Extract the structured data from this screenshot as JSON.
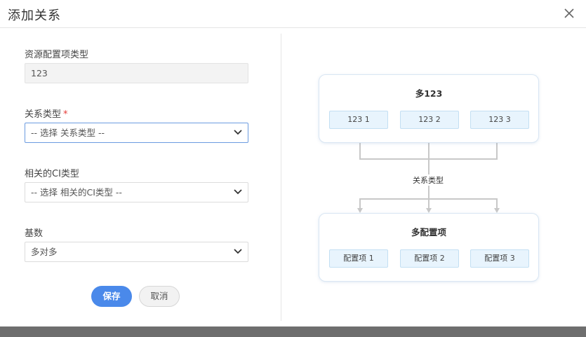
{
  "dialog": {
    "title": "添加关系",
    "close_icon": "close-icon"
  },
  "form": {
    "ci_type": {
      "label": "资源配置项类型",
      "value": "123"
    },
    "relation_type": {
      "label": "关系类型",
      "required_mark": "*",
      "value": "-- 选择 关系类型 --"
    },
    "related_ci_type": {
      "label": "相关的CI类型",
      "value": "-- 选择 相关的CI类型 --"
    },
    "cardinality": {
      "label": "基数",
      "value": "多对多"
    },
    "save_label": "保存",
    "cancel_label": "取消"
  },
  "diagram": {
    "top_title": "多123",
    "top_items": [
      "123 1",
      "123 2",
      "123 3"
    ],
    "relation_label": "关系类型",
    "bottom_title": "多配置项",
    "bottom_items": [
      "配置项 1",
      "配置项 2",
      "配置项 3"
    ]
  },
  "colors": {
    "accent": "#4a89ea",
    "required": "#e53935",
    "chip_bg": "#e8f4fd",
    "connector": "#c8c8c8"
  }
}
